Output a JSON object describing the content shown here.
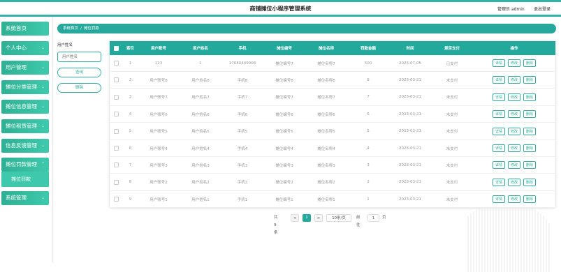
{
  "header": {
    "title": "商铺摊位小程序管理系统",
    "admin_label": "管理员 admin",
    "logout_label": "退出登录"
  },
  "sidebar": {
    "items": [
      {
        "label": "系统首页",
        "arrow": ""
      },
      {
        "label": "个人中心",
        "arrow": "⌄"
      },
      {
        "label": "用户管理",
        "arrow": "⌄"
      },
      {
        "label": "摊位分类管理",
        "arrow": "⌄"
      },
      {
        "label": "摊位信息管理",
        "arrow": "⌄"
      },
      {
        "label": "摊位租赁管理",
        "arrow": "⌄"
      },
      {
        "label": "信息反馈管理",
        "arrow": "⌄"
      },
      {
        "label": "摊位罚款管理",
        "arrow": "⌃"
      },
      {
        "label": "系统管理",
        "arrow": "⌄"
      }
    ],
    "active_sub": "摊位罚款"
  },
  "breadcrumb": {
    "home": "系统首页",
    "sep": "/",
    "current": "摊位罚款"
  },
  "search": {
    "label": "用户姓名",
    "placeholder": "用户姓名",
    "query_button": "查询",
    "delete_button": "删除"
  },
  "table": {
    "columns": [
      "索引",
      "用户账号",
      "用户姓名",
      "手机",
      "摊位编号",
      "摊位名称",
      "罚款金额",
      "时间",
      "是否支付",
      "操作"
    ],
    "actions": {
      "detail": "详情",
      "edit": "修改",
      "delete": "删除"
    },
    "rows": [
      {
        "index": "1",
        "account": "123",
        "name": "1",
        "phone": "17680449908",
        "stall_no": "摊位编号7",
        "stall_name": "摊位名称7",
        "amount": "500",
        "date": "2023-07-05",
        "paid": "已支付"
      },
      {
        "index": "2",
        "account": "用户账号8",
        "name": "用户姓名8",
        "phone": "手机8",
        "stall_no": "摊位编号8",
        "stall_name": "摊位名称8",
        "amount": "8",
        "date": "2023-03-21",
        "paid": "未支付"
      },
      {
        "index": "3",
        "account": "用户账号7",
        "name": "用户姓名7",
        "phone": "手机7",
        "stall_no": "摊位编号7",
        "stall_name": "摊位名称7",
        "amount": "7",
        "date": "2023-03-21",
        "paid": "未支付"
      },
      {
        "index": "4",
        "account": "用户账号6",
        "name": "用户姓名6",
        "phone": "手机6",
        "stall_no": "摊位编号6",
        "stall_name": "摊位名称6",
        "amount": "6",
        "date": "2023-03-21",
        "paid": "未支付"
      },
      {
        "index": "5",
        "account": "用户账号5",
        "name": "用户姓名5",
        "phone": "手机5",
        "stall_no": "摊位编号5",
        "stall_name": "摊位名称5",
        "amount": "5",
        "date": "2023-03-21",
        "paid": "未支付"
      },
      {
        "index": "6",
        "account": "用户账号4",
        "name": "用户姓名4",
        "phone": "手机4",
        "stall_no": "摊位编号4",
        "stall_name": "摊位名称4",
        "amount": "4",
        "date": "2023-03-21",
        "paid": "未支付"
      },
      {
        "index": "7",
        "account": "用户账号3",
        "name": "用户姓名3",
        "phone": "手机3",
        "stall_no": "摊位编号3",
        "stall_name": "摊位名称3",
        "amount": "3",
        "date": "2023-03-21",
        "paid": "未支付"
      },
      {
        "index": "8",
        "account": "用户账号2",
        "name": "用户姓名2",
        "phone": "手机2",
        "stall_no": "摊位编号2",
        "stall_name": "摊位名称2",
        "amount": "2",
        "date": "2023-03-21",
        "paid": "未支付"
      },
      {
        "index": "9",
        "account": "用户账号1",
        "name": "用户姓名1",
        "phone": "手机1",
        "stall_no": "摊位编号1",
        "stall_name": "摊位名称1",
        "amount": "1",
        "date": "2023-03-21",
        "paid": "未支付"
      }
    ]
  },
  "pagination": {
    "total": "共 9 条",
    "prev": "<",
    "current_page": "1",
    "next": ">",
    "page_size": "10条/页",
    "goto_label": "前往",
    "goto_value": "1",
    "page_unit": "页"
  },
  "colors": {
    "accent": "#22a99c",
    "menu": "#2fb094"
  }
}
